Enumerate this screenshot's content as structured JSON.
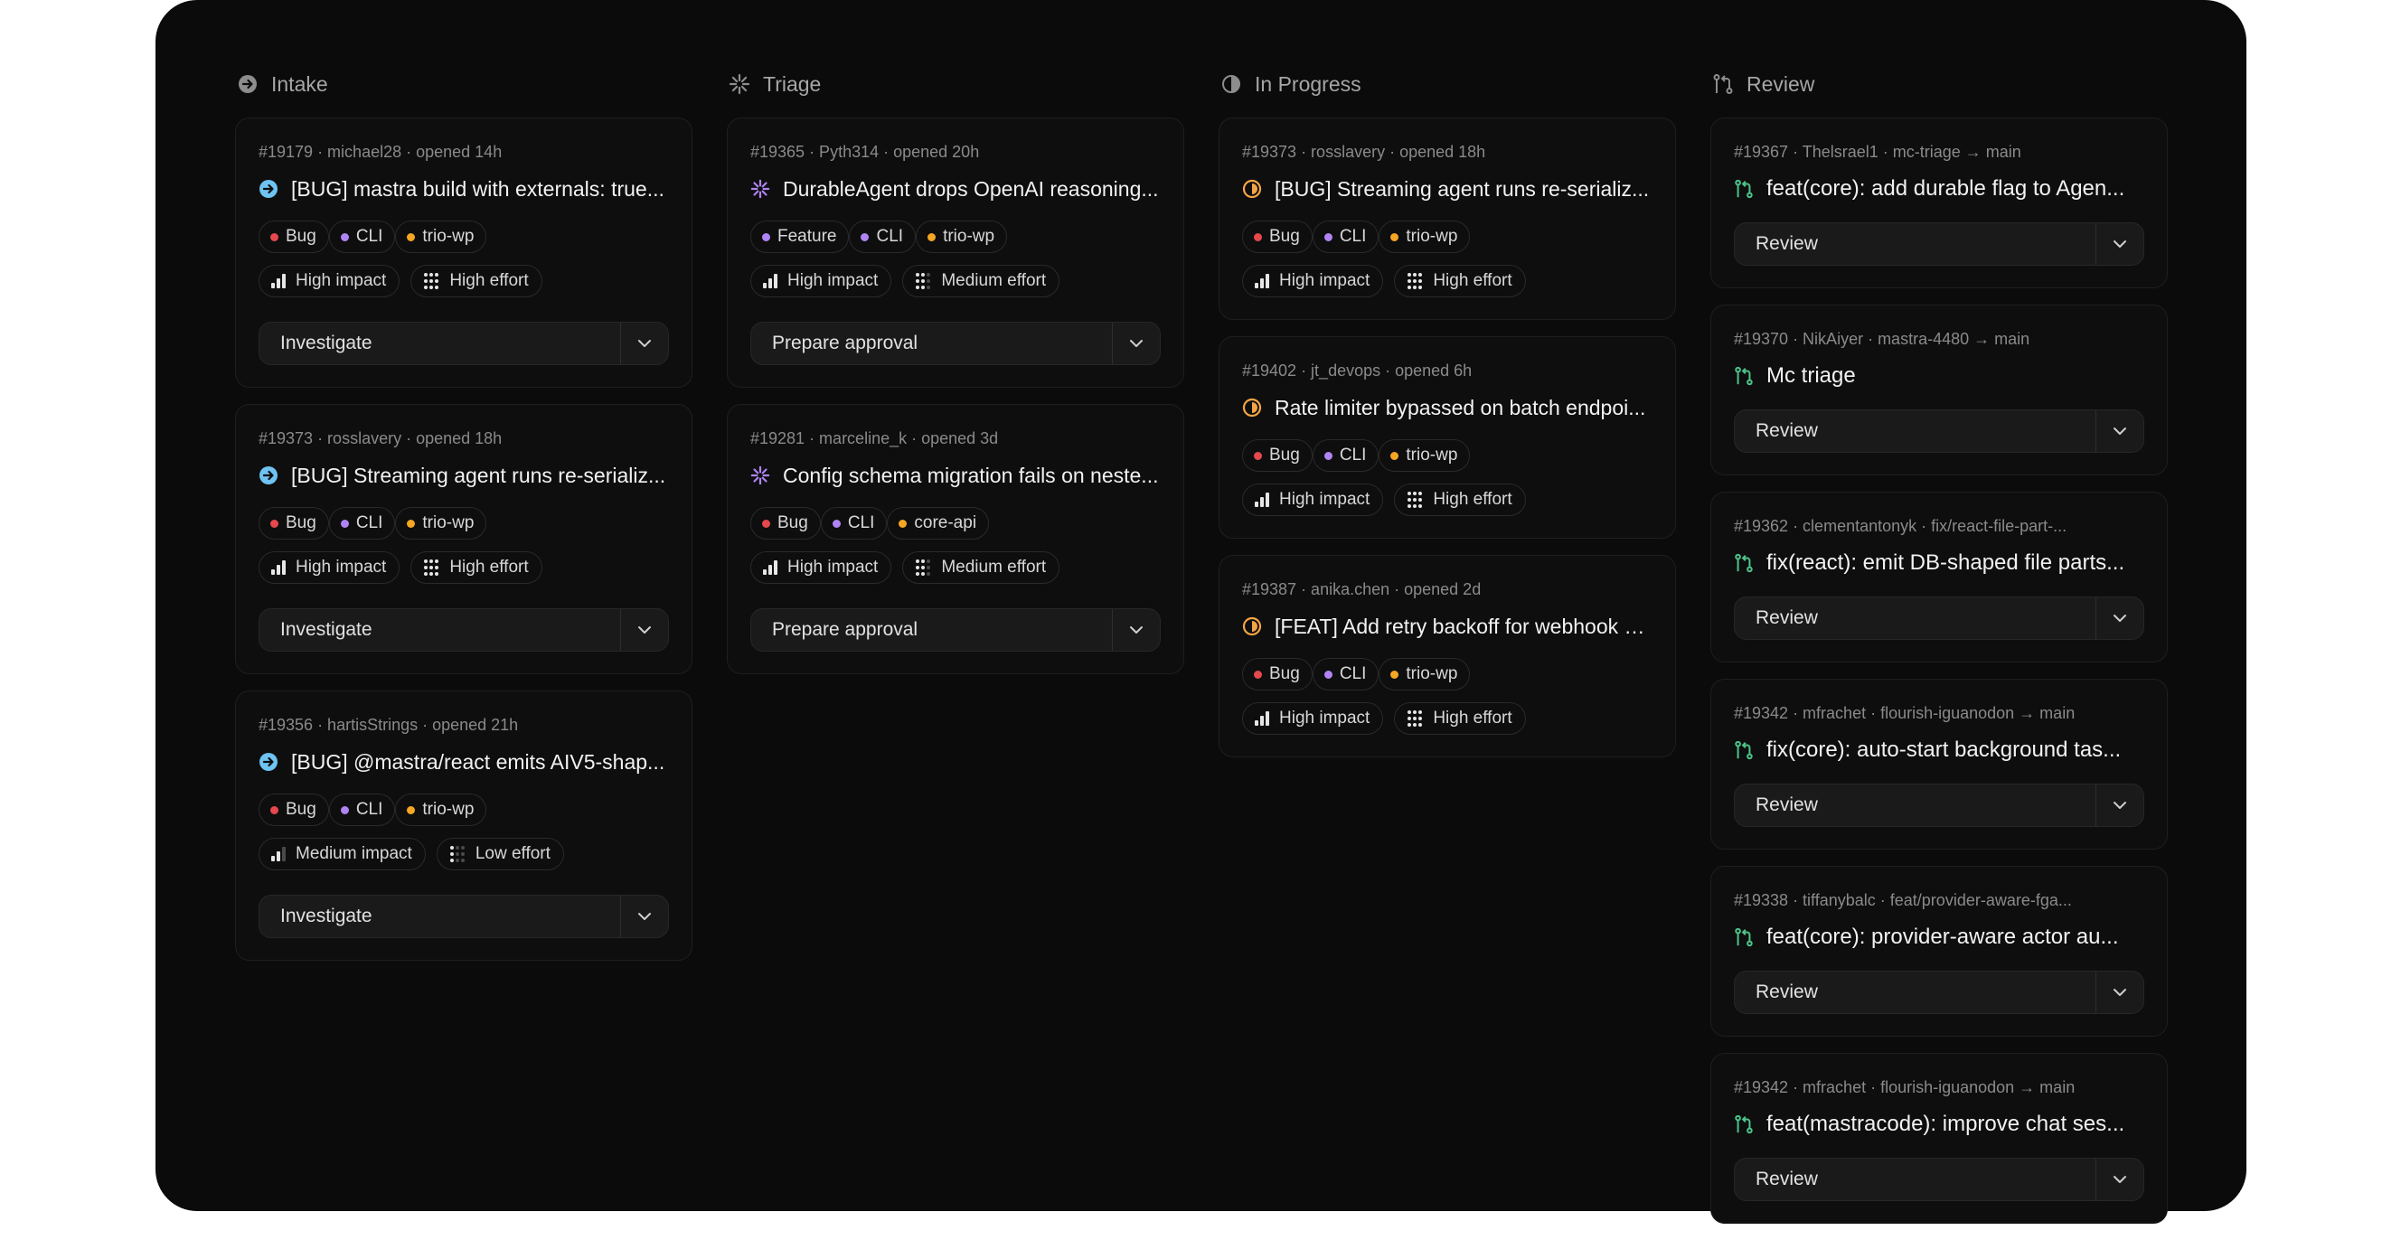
{
  "columns": [
    {
      "title": "Intake",
      "icon": "arrow-right-circle-icon",
      "cards": [
        {
          "meta": "#19179 · michael28 · opened 14h",
          "title": "[BUG] mastra build with externals: true...",
          "tags": [
            {
              "label": "Bug",
              "color": "#e5484d"
            },
            {
              "label": "CLI",
              "color": "#b084f5"
            },
            {
              "label": "trio-wp",
              "color": "#f5a623"
            }
          ],
          "impact": "High impact",
          "effort": "High effort",
          "action": "Investigate"
        },
        {
          "meta": "#19373 · rosslavery · opened 18h",
          "title": "[BUG] Streaming agent runs re-serializ...",
          "tags": [
            {
              "label": "Bug",
              "color": "#e5484d"
            },
            {
              "label": "CLI",
              "color": "#b084f5"
            },
            {
              "label": "trio-wp",
              "color": "#f5a623"
            }
          ],
          "impact": "High impact",
          "effort": "High effort",
          "action": "Investigate"
        },
        {
          "meta": "#19356 · hartisStrings · opened 21h",
          "title": "[BUG] @mastra/react emits AIV5-shap...",
          "tags": [
            {
              "label": "Bug",
              "color": "#e5484d"
            },
            {
              "label": "CLI",
              "color": "#b084f5"
            },
            {
              "label": "trio-wp",
              "color": "#f5a623"
            }
          ],
          "impact": "Medium impact",
          "effort": "Low effort",
          "action": "Investigate"
        }
      ]
    },
    {
      "title": "Triage",
      "icon": "sparkle-loader-icon",
      "cards": [
        {
          "meta": "#19365 · Pyth314 · opened 20h",
          "title": "DurableAgent drops OpenAI reasoning...",
          "tags": [
            {
              "label": "Feature",
              "color": "#b084f5"
            },
            {
              "label": "CLI",
              "color": "#b084f5"
            },
            {
              "label": "trio-wp",
              "color": "#f5a623"
            }
          ],
          "impact": "High impact",
          "effort": "Medium effort",
          "action": "Prepare approval"
        },
        {
          "meta": "#19281 · marceline_k · opened 3d",
          "title": "Config schema migration fails on neste...",
          "tags": [
            {
              "label": "Bug",
              "color": "#e5484d"
            },
            {
              "label": "CLI",
              "color": "#b084f5"
            },
            {
              "label": "core-api",
              "color": "#f5a623"
            }
          ],
          "impact": "High impact",
          "effort": "Medium effort",
          "action": "Prepare approval"
        }
      ]
    },
    {
      "title": "In Progress",
      "icon": "half-circle-icon",
      "cards": [
        {
          "meta": "#19373 · rosslavery · opened 18h",
          "title": "[BUG] Streaming agent runs re-serializ...",
          "tags": [
            {
              "label": "Bug",
              "color": "#e5484d"
            },
            {
              "label": "CLI",
              "color": "#b084f5"
            },
            {
              "label": "trio-wp",
              "color": "#f5a623"
            }
          ],
          "impact": "High impact",
          "effort": "High effort"
        },
        {
          "meta": "#19402 · jt_devops · opened 6h",
          "title": "Rate limiter bypassed on batch endpoi...",
          "tags": [
            {
              "label": "Bug",
              "color": "#e5484d"
            },
            {
              "label": "CLI",
              "color": "#b084f5"
            },
            {
              "label": "trio-wp",
              "color": "#f5a623"
            }
          ],
          "impact": "High impact",
          "effort": "High effort"
        },
        {
          "meta": "#19387 · anika.chen · opened 2d",
          "title": "[FEAT] Add retry backoff for webhook d...",
          "tags": [
            {
              "label": "Bug",
              "color": "#e5484d"
            },
            {
              "label": "CLI",
              "color": "#b084f5"
            },
            {
              "label": "trio-wp",
              "color": "#f5a623"
            }
          ],
          "impact": "High impact",
          "effort": "High effort"
        }
      ]
    },
    {
      "title": "Review",
      "icon": "pull-request-icon",
      "cards": [
        {
          "meta": "#19367 · Thelsrael1 · mc-triage → main",
          "title": "feat(core): add durable flag to Agen...",
          "action": "Review"
        },
        {
          "meta": "#19370 · NikAiyer · mastra-4480 → main",
          "title": "Mc triage",
          "action": "Review"
        },
        {
          "meta": "#19362 · clementantonyk · fix/react-file-part-...",
          "title": "fix(react): emit DB-shaped file parts...",
          "action": "Review"
        },
        {
          "meta": "#19342 · mfrachet · flourish-iguanodon → main",
          "title": "fix(core): auto-start background tas...",
          "action": "Review"
        },
        {
          "meta": "#19338 · tiffanybalc · feat/provider-aware-fga...",
          "title": "feat(core): provider-aware actor au...",
          "action": "Review"
        },
        {
          "meta": "#19342 · mfrachet · flourish-iguanodon → main",
          "title": "feat(mastracode): improve chat ses...",
          "action": "Review"
        }
      ]
    }
  ],
  "colors": {
    "board_bg": "#0b0b0b",
    "intake_accent": "#6ec3f2",
    "triage_accent": "#b084f5",
    "progress_accent": "#f5a544",
    "review_accent": "#4cc38a"
  }
}
